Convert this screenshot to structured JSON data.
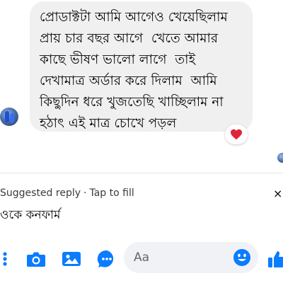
{
  "thread": {
    "message": {
      "lines": [
        "প্রোডাক্টটা আমি আগেও খেয়েছিলাম",
        "প্রায় চার বছর আগে  খেতে আমার",
        "কাছে ভীষণ ভালো লাগে  তাই",
        "দেখামাত্র অর্ডার করে দিলাম  আমি",
        "কিছুদিন ধরে খুজতেছি খাচ্ছিলাম না",
        "হঠাৎ এই মাত্র চোখে পড়ল"
      ],
      "reaction": "❤"
    }
  },
  "suggested_reply": {
    "header": "Suggested reply",
    "separator": "·",
    "action": "Tap to fill",
    "close": "×",
    "text": "ওকে কনফার্ম"
  },
  "composer": {
    "placeholder": "Aa",
    "icons": {
      "more": "more-icon",
      "camera": "camera-icon",
      "photo": "photo-icon",
      "voice": "mic-icon",
      "emoji": "emoji-icon",
      "like": "thumbs-up-icon"
    }
  },
  "colors": {
    "accent": "#0a7cff",
    "bubble_bg": "#f0f0f0",
    "reaction": "#e0243a",
    "composer_bg": "#f0f2f5",
    "secondary_text": "#65676b"
  }
}
